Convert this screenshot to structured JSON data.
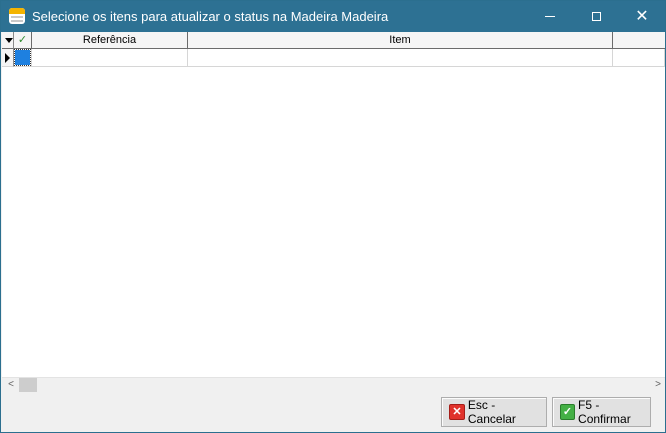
{
  "window": {
    "title": "Selecione os itens para atualizar o status na Madeira Madeira",
    "controls": {
      "minimize": "minimize-icon",
      "maximize": "maximize-icon",
      "close": "close-icon"
    }
  },
  "grid": {
    "check_header_icon": "✓",
    "columns": [
      "Referência",
      "Item"
    ],
    "rows": [
      {
        "referencia": "",
        "item": ""
      }
    ]
  },
  "scrollbar": {
    "left_arrow": "<",
    "right_arrow": ">"
  },
  "buttons": {
    "cancel_label": "Esc - Cancelar",
    "confirm_label": "F5 - Confirmar"
  },
  "colors": {
    "titlebar": "#2d7193",
    "selection": "#1e80e0"
  }
}
